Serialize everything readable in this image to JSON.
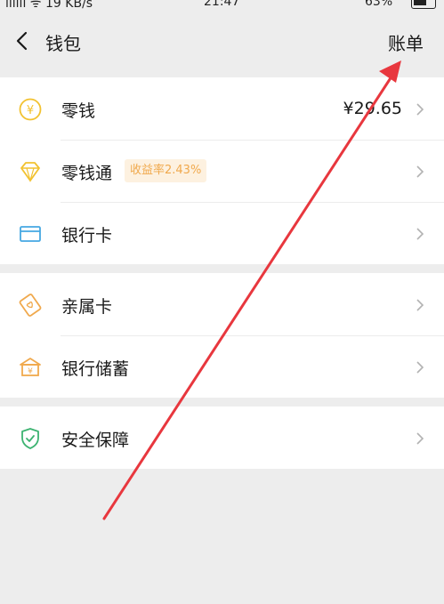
{
  "status_bar": {
    "signal_speed": "ıllıll ᯤ 19 KB/s",
    "time": "21:47",
    "battery": "63%"
  },
  "nav": {
    "title": "钱包",
    "action": "账单"
  },
  "groups": [
    {
      "items": [
        {
          "label": "零钱",
          "value": "¥29.65",
          "icon": "yuan-coin-icon"
        },
        {
          "label": "零钱通",
          "badge": "收益率2.43%",
          "icon": "diamond-icon"
        },
        {
          "label": "银行卡",
          "icon": "bank-card-icon"
        }
      ]
    },
    {
      "items": [
        {
          "label": "亲属卡",
          "icon": "family-card-icon"
        },
        {
          "label": "银行储蓄",
          "icon": "bank-savings-icon"
        }
      ]
    },
    {
      "items": [
        {
          "label": "安全保障",
          "icon": "shield-icon"
        }
      ]
    }
  ],
  "colors": {
    "background": "#ededed",
    "yellow_icon": "#f2c230",
    "blue_icon": "#45a8e2",
    "orange_icon": "#f0a94d",
    "green_icon": "#3cb371",
    "annotation_arrow": "#e8373e"
  }
}
